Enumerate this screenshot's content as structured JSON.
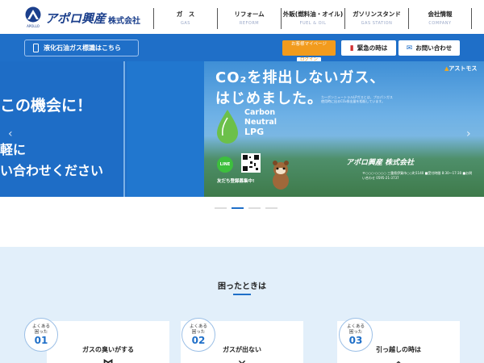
{
  "header": {
    "logo_text": "アポロ興産",
    "logo_suffix": "株式会社",
    "logo_caption": "APOLLO",
    "nav": [
      {
        "jp": "ガ　ス",
        "en": "GAS"
      },
      {
        "jp": "リフォーム",
        "en": "REFORM"
      },
      {
        "jp": "外販(燃料油・オイル)",
        "en": "FUEL & OIL"
      },
      {
        "jp": "ガソリンスタンド",
        "en": "GAS STATION"
      },
      {
        "jp": "会社情報",
        "en": "COMPANY"
      }
    ]
  },
  "bluebar": {
    "lpg_label": "液化石油ガス標識はこちら",
    "mypage_top": "お客様マイページ",
    "mypage_login": "ログイン",
    "emergency_label": "緊急の時は",
    "contact_label": "お問い合わせ"
  },
  "slider": {
    "left_line1": "この機会に！",
    "left_line2": "軽に",
    "left_line3": "い合わせください",
    "title_line1": "CO₂を排出しないガス、",
    "title_line2": "はじめました。",
    "small_text": "カーボンニュートラルLPガスとは、プロパンガス使用時に出るCO₂排出量を相殺しています。",
    "brand": "アストモス",
    "cn_line1": "Carbon",
    "cn_line2": "Neutral",
    "cn_line3": "LPG",
    "line_label": "LINE",
    "qr_caption": "友だち登録募集中!",
    "company_logo": "アポロ興産 株式会社",
    "company_info": "〒○○○-○○○○ 三重県伊賀市○○町1140 ■受付時間 8:30〜17:30 ■お問い合わせ 0595-21-3737",
    "active_dot": 1,
    "dot_count": 4
  },
  "trouble": {
    "title": "困ったときは",
    "cards": [
      {
        "b1": "よくある",
        "b2": "困った",
        "num": "01",
        "label": "ガスの臭いがする"
      },
      {
        "b1": "よくある",
        "b2": "困った",
        "num": "02",
        "label": "ガスが出ない"
      },
      {
        "b1": "よくある",
        "b2": "困った",
        "num": "03",
        "label": "引っ越しの時は"
      }
    ]
  },
  "colors": {
    "primary": "#1f6fc8",
    "accent_orange": "#f29b1d",
    "section_bg": "#e2effa",
    "logo_navy": "#1b3f8c"
  }
}
